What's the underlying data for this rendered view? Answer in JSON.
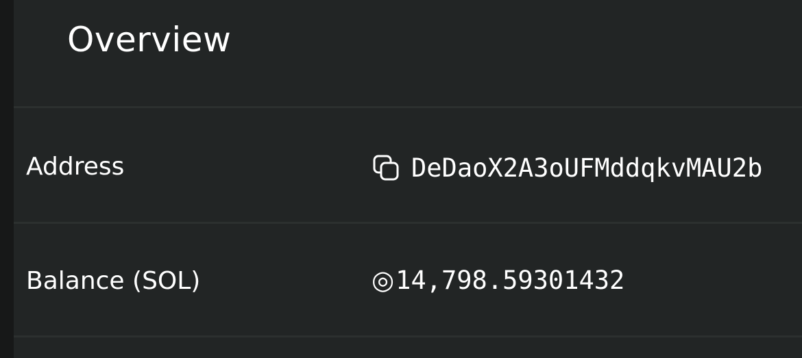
{
  "overview": {
    "title": "Overview"
  },
  "rows": [
    {
      "label": "Address",
      "value": "DeDaoX2A3oUFMddqkvMAU2b",
      "icon": "copy-icon"
    },
    {
      "label": "Balance (SOL)",
      "value": "14,798.59301432",
      "icon": "◎"
    }
  ],
  "colors": {
    "page_bg": "#1b1d1d",
    "card_bg": "#222525",
    "divider": "#2c302f",
    "text": "#ffffff"
  }
}
